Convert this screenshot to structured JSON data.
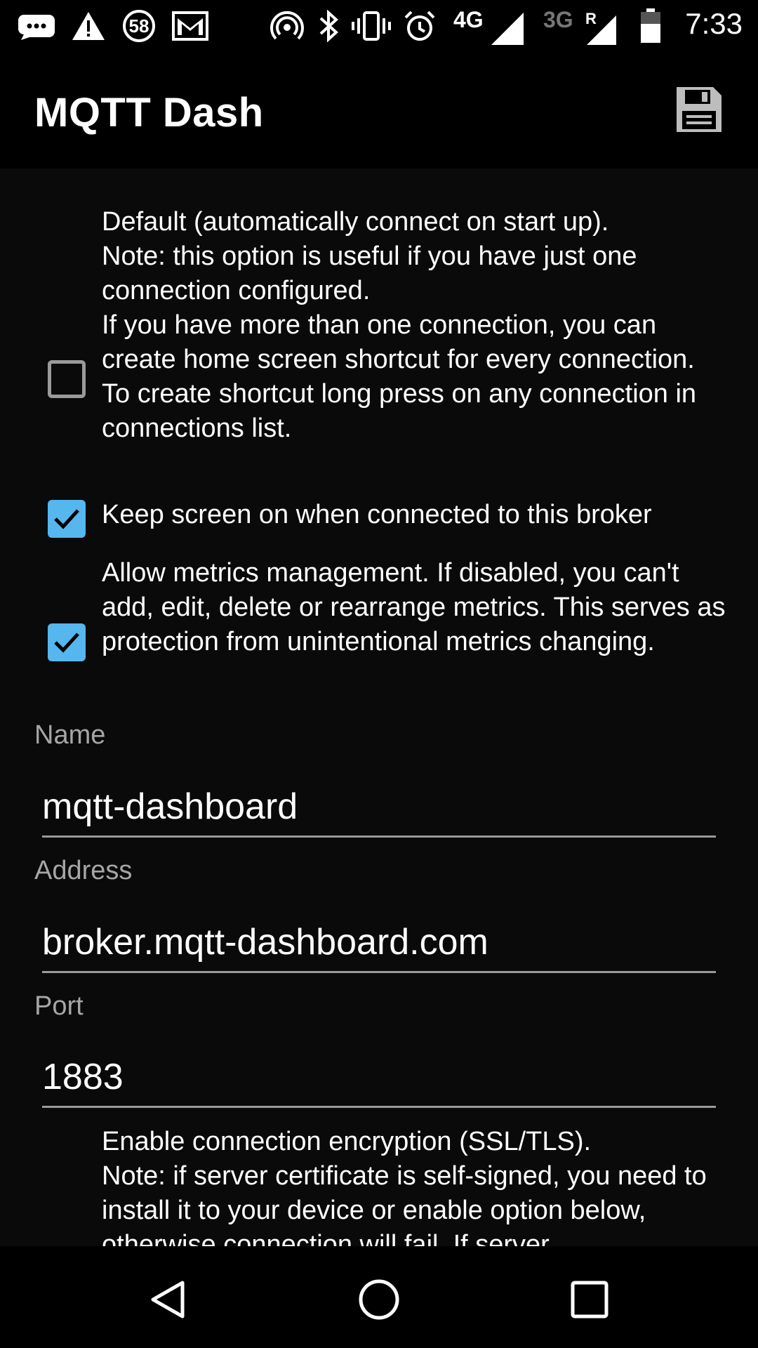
{
  "status_bar": {
    "time": "7:33",
    "notification_count": "58",
    "network_primary": "4G",
    "network_secondary": "3G",
    "roaming_label": "R",
    "icons": [
      "more-notifications-icon",
      "warning-icon",
      "badge-58-icon",
      "gmail-icon",
      "hotspot-icon",
      "bluetooth-icon",
      "vibrate-icon",
      "alarm-icon",
      "signal-4g-icon",
      "signal-3g-roaming-icon",
      "battery-icon"
    ]
  },
  "app_bar": {
    "title": "MQTT Dash",
    "action_icon": "save-icon"
  },
  "options": [
    {
      "checked": false,
      "text": "Default (automatically connect on start up).\nNote: this option is useful if you have just one connection configured.\nIf you have more than one connection, you can create home screen shortcut for every connection.\nTo create shortcut long press on any connection in connections list."
    },
    {
      "checked": true,
      "text": "Keep screen on when connected to this broker"
    },
    {
      "checked": true,
      "text": "Allow metrics management. If disabled, you can't add, edit, delete or rearrange metrics. This serves as protection from unintentional metrics changing."
    }
  ],
  "fields": {
    "name": {
      "label": "Name",
      "value": "mqtt-dashboard"
    },
    "address": {
      "label": "Address",
      "value": "broker.mqtt-dashboard.com"
    },
    "port": {
      "label": "Port",
      "value": "1883"
    }
  },
  "encryption_option": {
    "text": "Enable connection encryption (SSL/TLS).\nNote: if server certificate is self-signed, you need to install it to your device or enable option below, otherwise connection will fail. If server"
  },
  "nav_bar": {
    "buttons": [
      "back-icon",
      "home-icon",
      "recents-icon"
    ]
  },
  "colors": {
    "background": "#0a0a0a",
    "bars": "#000000",
    "accent": "#56b6ee",
    "label": "#a6a6a6"
  }
}
